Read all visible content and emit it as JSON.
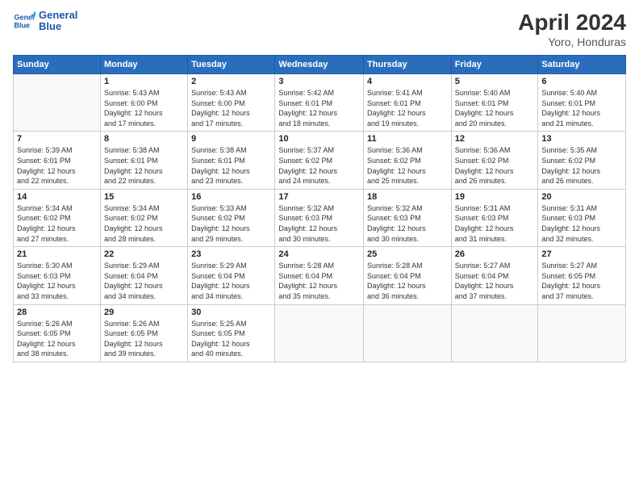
{
  "header": {
    "logo_line1": "General",
    "logo_line2": "Blue",
    "month": "April 2024",
    "location": "Yoro, Honduras"
  },
  "weekdays": [
    "Sunday",
    "Monday",
    "Tuesday",
    "Wednesday",
    "Thursday",
    "Friday",
    "Saturday"
  ],
  "weeks": [
    [
      {
        "day": "",
        "info": ""
      },
      {
        "day": "1",
        "info": "Sunrise: 5:43 AM\nSunset: 6:00 PM\nDaylight: 12 hours\nand 17 minutes."
      },
      {
        "day": "2",
        "info": "Sunrise: 5:43 AM\nSunset: 6:00 PM\nDaylight: 12 hours\nand 17 minutes."
      },
      {
        "day": "3",
        "info": "Sunrise: 5:42 AM\nSunset: 6:01 PM\nDaylight: 12 hours\nand 18 minutes."
      },
      {
        "day": "4",
        "info": "Sunrise: 5:41 AM\nSunset: 6:01 PM\nDaylight: 12 hours\nand 19 minutes."
      },
      {
        "day": "5",
        "info": "Sunrise: 5:40 AM\nSunset: 6:01 PM\nDaylight: 12 hours\nand 20 minutes."
      },
      {
        "day": "6",
        "info": "Sunrise: 5:40 AM\nSunset: 6:01 PM\nDaylight: 12 hours\nand 21 minutes."
      }
    ],
    [
      {
        "day": "7",
        "info": "Sunrise: 5:39 AM\nSunset: 6:01 PM\nDaylight: 12 hours\nand 22 minutes."
      },
      {
        "day": "8",
        "info": "Sunrise: 5:38 AM\nSunset: 6:01 PM\nDaylight: 12 hours\nand 22 minutes."
      },
      {
        "day": "9",
        "info": "Sunrise: 5:38 AM\nSunset: 6:01 PM\nDaylight: 12 hours\nand 23 minutes."
      },
      {
        "day": "10",
        "info": "Sunrise: 5:37 AM\nSunset: 6:02 PM\nDaylight: 12 hours\nand 24 minutes."
      },
      {
        "day": "11",
        "info": "Sunrise: 5:36 AM\nSunset: 6:02 PM\nDaylight: 12 hours\nand 25 minutes."
      },
      {
        "day": "12",
        "info": "Sunrise: 5:36 AM\nSunset: 6:02 PM\nDaylight: 12 hours\nand 26 minutes."
      },
      {
        "day": "13",
        "info": "Sunrise: 5:35 AM\nSunset: 6:02 PM\nDaylight: 12 hours\nand 26 minutes."
      }
    ],
    [
      {
        "day": "14",
        "info": "Sunrise: 5:34 AM\nSunset: 6:02 PM\nDaylight: 12 hours\nand 27 minutes."
      },
      {
        "day": "15",
        "info": "Sunrise: 5:34 AM\nSunset: 6:02 PM\nDaylight: 12 hours\nand 28 minutes."
      },
      {
        "day": "16",
        "info": "Sunrise: 5:33 AM\nSunset: 6:02 PM\nDaylight: 12 hours\nand 29 minutes."
      },
      {
        "day": "17",
        "info": "Sunrise: 5:32 AM\nSunset: 6:03 PM\nDaylight: 12 hours\nand 30 minutes."
      },
      {
        "day": "18",
        "info": "Sunrise: 5:32 AM\nSunset: 6:03 PM\nDaylight: 12 hours\nand 30 minutes."
      },
      {
        "day": "19",
        "info": "Sunrise: 5:31 AM\nSunset: 6:03 PM\nDaylight: 12 hours\nand 31 minutes."
      },
      {
        "day": "20",
        "info": "Sunrise: 5:31 AM\nSunset: 6:03 PM\nDaylight: 12 hours\nand 32 minutes."
      }
    ],
    [
      {
        "day": "21",
        "info": "Sunrise: 5:30 AM\nSunset: 6:03 PM\nDaylight: 12 hours\nand 33 minutes."
      },
      {
        "day": "22",
        "info": "Sunrise: 5:29 AM\nSunset: 6:04 PM\nDaylight: 12 hours\nand 34 minutes."
      },
      {
        "day": "23",
        "info": "Sunrise: 5:29 AM\nSunset: 6:04 PM\nDaylight: 12 hours\nand 34 minutes."
      },
      {
        "day": "24",
        "info": "Sunrise: 5:28 AM\nSunset: 6:04 PM\nDaylight: 12 hours\nand 35 minutes."
      },
      {
        "day": "25",
        "info": "Sunrise: 5:28 AM\nSunset: 6:04 PM\nDaylight: 12 hours\nand 36 minutes."
      },
      {
        "day": "26",
        "info": "Sunrise: 5:27 AM\nSunset: 6:04 PM\nDaylight: 12 hours\nand 37 minutes."
      },
      {
        "day": "27",
        "info": "Sunrise: 5:27 AM\nSunset: 6:05 PM\nDaylight: 12 hours\nand 37 minutes."
      }
    ],
    [
      {
        "day": "28",
        "info": "Sunrise: 5:26 AM\nSunset: 6:05 PM\nDaylight: 12 hours\nand 38 minutes."
      },
      {
        "day": "29",
        "info": "Sunrise: 5:26 AM\nSunset: 6:05 PM\nDaylight: 12 hours\nand 39 minutes."
      },
      {
        "day": "30",
        "info": "Sunrise: 5:25 AM\nSunset: 6:05 PM\nDaylight: 12 hours\nand 40 minutes."
      },
      {
        "day": "",
        "info": ""
      },
      {
        "day": "",
        "info": ""
      },
      {
        "day": "",
        "info": ""
      },
      {
        "day": "",
        "info": ""
      }
    ]
  ]
}
